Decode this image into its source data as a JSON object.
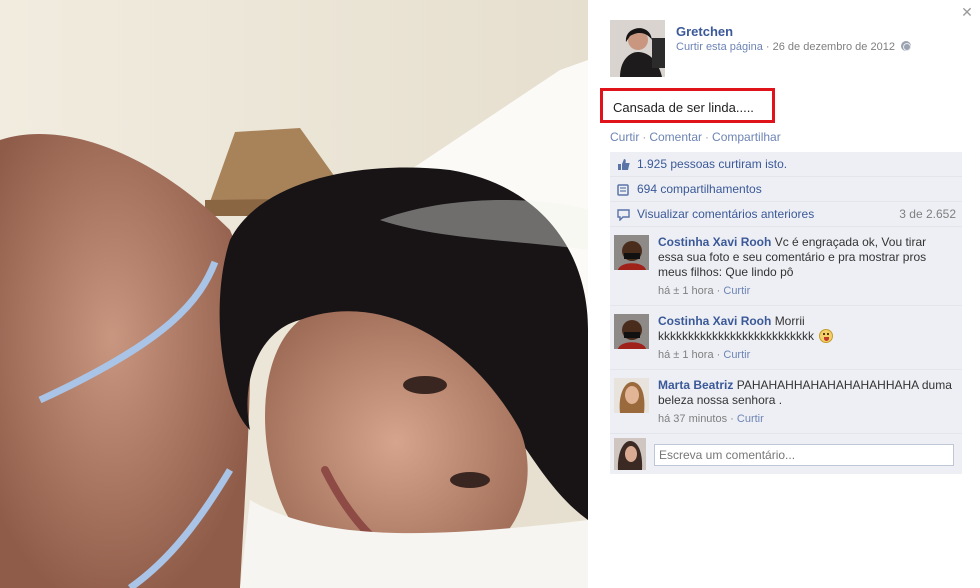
{
  "post": {
    "author": "Gretchen",
    "like_page": "Curtir esta página",
    "separator": "·",
    "date": "26 de dezembro de 2012",
    "caption": "Cansada de ser linda.....",
    "actions": [
      "Curtir",
      "Comentar",
      "Compartilhar"
    ]
  },
  "ufi": {
    "likes": "1.925 pessoas curtiram isto.",
    "shares": "694 compartilhamentos",
    "view_previous": "Visualizar comentários anteriores",
    "count": "3 de 2.652"
  },
  "comments": [
    {
      "author": "Costinha Xavi Rooh",
      "text": "Vc é engraçada ok, Vou tirar essa sua foto e seu comentário e pra mostrar pros meus filhos: Que lindo pô",
      "time": "há ± 1 hora",
      "like": "Curtir"
    },
    {
      "author": "Costinha Xavi Rooh",
      "text": "Morrii kkkkkkkkkkkkkkkkkkkkkkkkkk",
      "time": "há ± 1 hora",
      "like": "Curtir",
      "emoji": "tongue-out-emoji"
    },
    {
      "author": "Marta Beatriz",
      "text": "PAHAHAHHAHAHAHAHAHHAHA duma beleza nossa senhora .",
      "time": "há 37 minutos",
      "like": "Curtir"
    }
  ],
  "compose": {
    "placeholder": "Escreva um comentário..."
  },
  "icons": {
    "close": "close-icon",
    "audience": "globe-icon",
    "likes": "thumbs-up-icon",
    "shares": "share-icon",
    "comments": "comment-bubble-icon"
  },
  "colors": {
    "link": "#3b5998",
    "ufi_bg": "#edeff4",
    "highlight": "#e0131a"
  }
}
